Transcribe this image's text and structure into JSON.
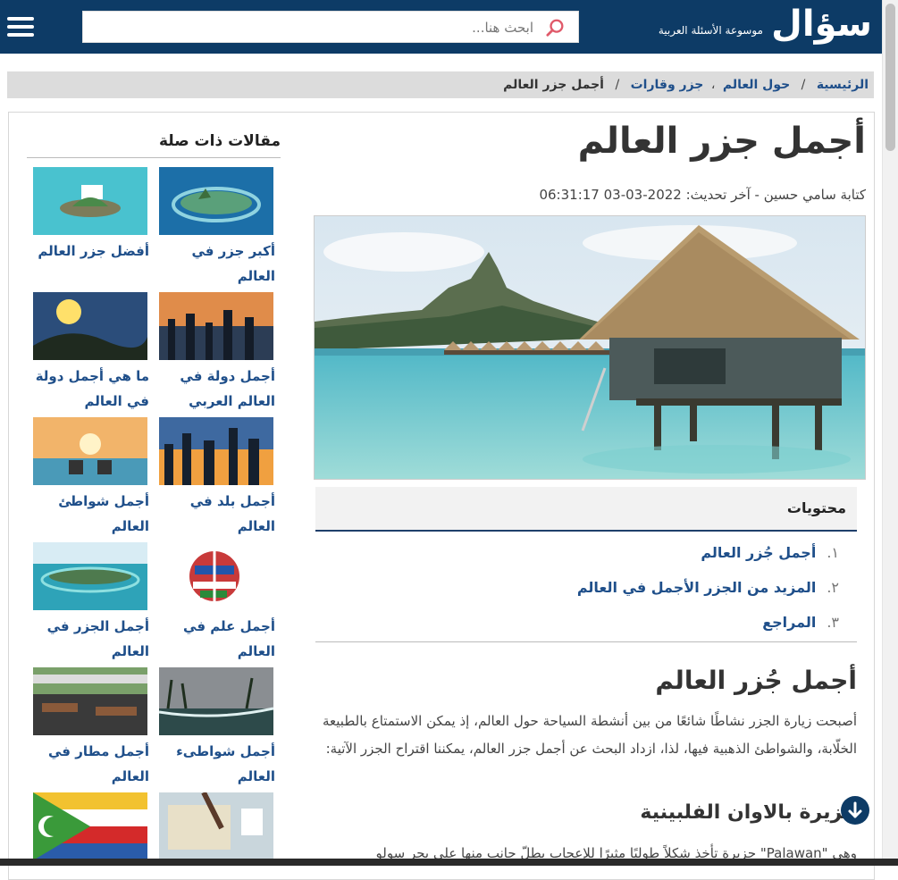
{
  "header": {
    "logo": "سؤال",
    "tagline": "موسوعة الأسئلة العربية",
    "search_placeholder": "ابحث هنا..."
  },
  "breadcrumb": {
    "home": "الرئيسية",
    "l2": "حول العالم",
    "l3": "جزر وقارات",
    "current": "أجمل جزر العالم"
  },
  "article": {
    "title": "أجمل جزر العالم",
    "byline": "كتابة سامي حسين - آخر تحديث: 2022-03-03 06:31:17",
    "toc": {
      "heading": "محتويات",
      "items": [
        {
          "num": "١.",
          "label": "أجمل جُزر العالم"
        },
        {
          "num": "٢.",
          "label": "المزيد من الجزر الأجمل في العالم"
        },
        {
          "num": "٣.",
          "label": "المراجع"
        }
      ]
    },
    "section_title": "أجمل جُزر العالم",
    "paragraph": "أصبحت زيارة الجزر نشاطًا شائعًا من بين أنشطة السياحة حول العالم، إذ يمكن الاستمتاع بالطبيعة الخلّابة، والشواطئ الذهبية فيها، لذا، ازداد البحث عن أجمل جزر العالم، يمكننا اقتراح الجزر الآتية:",
    "sub_title": "جزيرة بالاوان الفلبينية",
    "paragraph2": "وهي \"Palawan\" جزيرة تأخذ شكلاً طوليًا مثيرًا للإعجاب يطلّ جانب منها على بحر سولو"
  },
  "related": {
    "heading": "مقالات ذات صلة",
    "cards": [
      {
        "label": "أكبر جزر في العالم"
      },
      {
        "label": "أفضل جزر العالم"
      },
      {
        "label": "أجمل دولة في العالم العربي"
      },
      {
        "label": "ما هي أجمل دولة في العالم"
      },
      {
        "label": "أجمل بلد في العالم"
      },
      {
        "label": "أجمل شواطئ العالم"
      },
      {
        "label": "أجمل علم في العالم"
      },
      {
        "label": "أجمل الجزر في العالم"
      },
      {
        "label": "أجمل شواطىء العالم"
      },
      {
        "label": "أجمل مطار في العالم"
      }
    ]
  },
  "colors": {
    "brand": "#0d3b66",
    "link": "#1f4f8a"
  }
}
